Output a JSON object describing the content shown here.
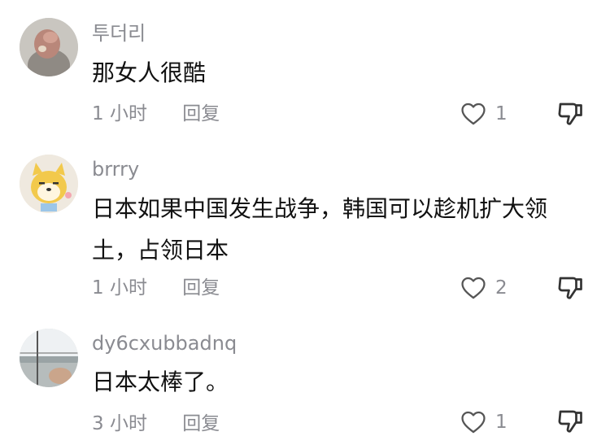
{
  "comments": [
    {
      "avatar": "parrot-photo",
      "username": "투더리",
      "text": "那女人很酷",
      "time": "1 小时",
      "reply_label": "回复",
      "likes": "1"
    },
    {
      "avatar": "cartoon-shiba-dog",
      "username": "brrry",
      "text": "日本如果中国发生战争，韩国可以趁机扩大领土，占领日本",
      "time": "1 小时",
      "reply_label": "回复",
      "likes": "2"
    },
    {
      "avatar": "window-view-photo",
      "username": "dy6cxubbadnq",
      "text": "日本太棒了。",
      "time": "3 小时",
      "reply_label": "回复",
      "likes": "1"
    }
  ],
  "icons": {
    "like": "heart-outline-icon",
    "dislike": "thumbs-down-icon"
  },
  "colors": {
    "secondary_text": "#8a8b91",
    "primary_text": "#111111"
  }
}
